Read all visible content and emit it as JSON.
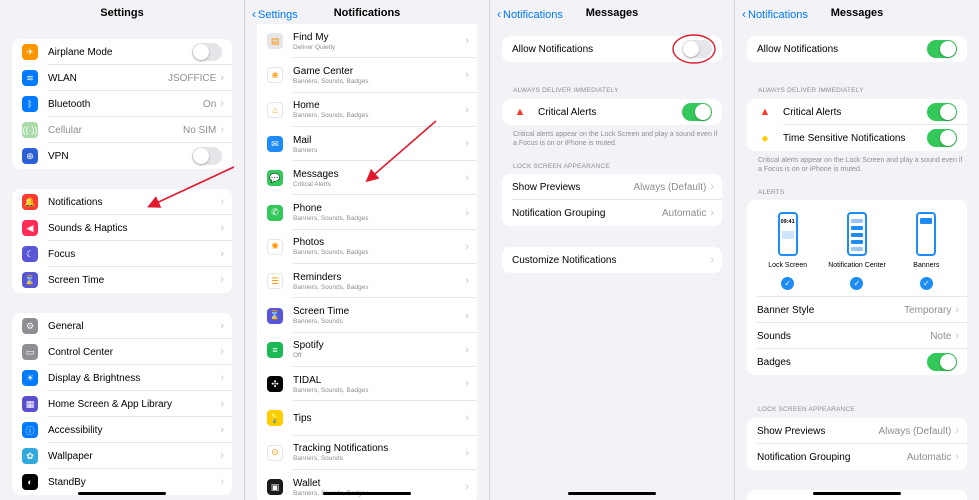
{
  "p1": {
    "title": "Settings",
    "group1": [
      {
        "label": "Airplane Mode",
        "icon": "airplane-icon",
        "color": "#ff9500",
        "glyph": "✈",
        "toggle": "off"
      },
      {
        "label": "WLAN",
        "icon": "wifi-icon",
        "color": "#007aff",
        "glyph": "≋",
        "value": "JSOFFICE"
      },
      {
        "label": "Bluetooth",
        "icon": "bluetooth-icon",
        "color": "#007aff",
        "glyph": "ᛒ",
        "value": "On"
      },
      {
        "label": "Cellular",
        "icon": "cellular-icon",
        "color": "#a8dba8",
        "glyph": "((·))",
        "value": "No SIM",
        "dim": true
      },
      {
        "label": "VPN",
        "icon": "vpn-icon",
        "color": "#2c5fd6",
        "glyph": "⊕",
        "toggle": "off"
      }
    ],
    "group2": [
      {
        "label": "Notifications",
        "icon": "bell-icon",
        "color": "#ff3b30",
        "glyph": "🔔"
      },
      {
        "label": "Sounds & Haptics",
        "icon": "speaker-icon",
        "color": "#ff2d55",
        "glyph": "◀"
      },
      {
        "label": "Focus",
        "icon": "moon-icon",
        "color": "#5856d6",
        "glyph": "☾"
      },
      {
        "label": "Screen Time",
        "icon": "hourglass-icon",
        "color": "#5856d6",
        "glyph": "⌛"
      }
    ],
    "group3": [
      {
        "label": "General",
        "icon": "gear-icon",
        "color": "#8e8e93",
        "glyph": "⚙"
      },
      {
        "label": "Control Center",
        "icon": "control-center-icon",
        "color": "#8e8e93",
        "glyph": "▭"
      },
      {
        "label": "Display & Brightness",
        "icon": "sun-icon",
        "color": "#007aff",
        "glyph": "☀"
      },
      {
        "label": "Home Screen & App Library",
        "icon": "grid-icon",
        "color": "#5a4fcf",
        "glyph": "▦"
      },
      {
        "label": "Accessibility",
        "icon": "accessibility-icon",
        "color": "#007aff",
        "glyph": "ⓘ"
      },
      {
        "label": "Wallpaper",
        "icon": "flower-icon",
        "color": "#34aadc",
        "glyph": "✿"
      },
      {
        "label": "StandBy",
        "icon": "standby-icon",
        "color": "#000000",
        "glyph": "◐"
      }
    ]
  },
  "p2": {
    "back": "Settings",
    "title": "Notifications",
    "apps": [
      {
        "name": "Find My",
        "sub": "Deliver Quietly",
        "icon": "find-my-icon",
        "color": "#e5e5ea",
        "glyph": "▤"
      },
      {
        "name": "Game Center",
        "sub": "Banners, Sounds, Badges",
        "icon": "game-center-icon",
        "color": "#ffffff",
        "glyph": "❀"
      },
      {
        "name": "Home",
        "sub": "Banners, Sounds, Badges",
        "icon": "home-icon",
        "color": "#ffffff",
        "glyph": "⌂"
      },
      {
        "name": "Mail",
        "sub": "Banners",
        "icon": "mail-icon",
        "color": "#1e8cf5",
        "glyph": "✉"
      },
      {
        "name": "Messages",
        "sub": "Critical Alerts",
        "icon": "messages-icon",
        "color": "#34c759",
        "glyph": "💬"
      },
      {
        "name": "Phone",
        "sub": "Banners, Sounds, Badges",
        "icon": "phone-icon",
        "color": "#34c759",
        "glyph": "✆"
      },
      {
        "name": "Photos",
        "sub": "Banners, Sounds, Badges",
        "icon": "photos-icon",
        "color": "#ffffff",
        "glyph": "✺"
      },
      {
        "name": "Reminders",
        "sub": "Banners, Sounds, Badges",
        "icon": "reminders-icon",
        "color": "#ffffff",
        "glyph": "☰"
      },
      {
        "name": "Screen Time",
        "sub": "Banners, Sounds",
        "icon": "hourglass-icon",
        "color": "#5856d6",
        "glyph": "⌛"
      },
      {
        "name": "Spotify",
        "sub": "Off",
        "icon": "spotify-icon",
        "color": "#1db954",
        "glyph": "≡"
      },
      {
        "name": "TIDAL",
        "sub": "Banners, Sounds, Badges",
        "icon": "tidal-icon",
        "color": "#000000",
        "glyph": "✣"
      },
      {
        "name": "Tips",
        "sub": "",
        "icon": "lightbulb-icon",
        "color": "#ffcc00",
        "glyph": "💡"
      },
      {
        "name": "Tracking Notifications",
        "sub": "Banners, Sounds",
        "icon": "tracking-icon",
        "color": "#ffffff",
        "glyph": "⊙"
      },
      {
        "name": "Wallet",
        "sub": "Banners, Sounds, Badges",
        "icon": "wallet-icon",
        "color": "#1c1c1e",
        "glyph": "▣"
      }
    ]
  },
  "p3": {
    "back": "Notifications",
    "title": "Messages",
    "allow": "Allow Notifications",
    "sect_always": "ALWAYS DELIVER IMMEDIATELY",
    "critical": "Critical Alerts",
    "critical_foot": "Critical alerts appear on the Lock Screen and play a sound even if a Focus is on or iPhone is muted.",
    "sect_lock": "LOCK SCREEN APPEARANCE",
    "show_previews": "Show Previews",
    "show_previews_val": "Always (Default)",
    "grouping": "Notification Grouping",
    "grouping_val": "Automatic",
    "customize": "Customize Notifications"
  },
  "p4": {
    "back": "Notifications",
    "title": "Messages",
    "allow": "Allow Notifications",
    "sect_always": "ALWAYS DELIVER IMMEDIATELY",
    "critical": "Critical Alerts",
    "time_sensitive": "Time Sensitive Notifications",
    "critical_foot": "Critical alerts appear on the Lock Screen and play a sound even if a Focus is on or iPhone is muted.",
    "sect_alerts": "ALERTS",
    "lock_screen": "Lock Screen",
    "lock_time": "09:41",
    "notif_center": "Notification Center",
    "banners": "Banners",
    "banner_style": "Banner Style",
    "banner_style_val": "Temporary",
    "sounds": "Sounds",
    "sounds_val": "Note",
    "badges": "Badges",
    "sect_lock": "LOCK SCREEN APPEARANCE",
    "show_previews": "Show Previews",
    "show_previews_val": "Always (Default)",
    "grouping": "Notification Grouping",
    "grouping_val": "Automatic"
  },
  "colors": {
    "accent": "#007aff",
    "toggle_on": "#34c759",
    "annotation": "#e0192d"
  }
}
